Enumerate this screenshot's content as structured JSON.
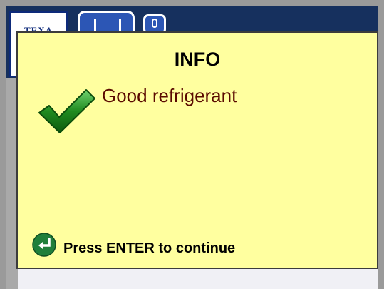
{
  "header": {
    "logo_text": "TEXA",
    "icons": [
      "refrigerant-station-icon",
      "bottle-icon"
    ]
  },
  "dialog": {
    "title": "INFO",
    "message": "Good refrigerant",
    "status_icon": "checkmark-icon",
    "footer_icon": "enter-key-icon",
    "footer_text": "Press ENTER to continue"
  },
  "colors": {
    "dialog_background": "#ffff9f",
    "message_text": "#5a0a00",
    "check_green": "#1f8a1f",
    "header_blue": "#2c56b5"
  }
}
